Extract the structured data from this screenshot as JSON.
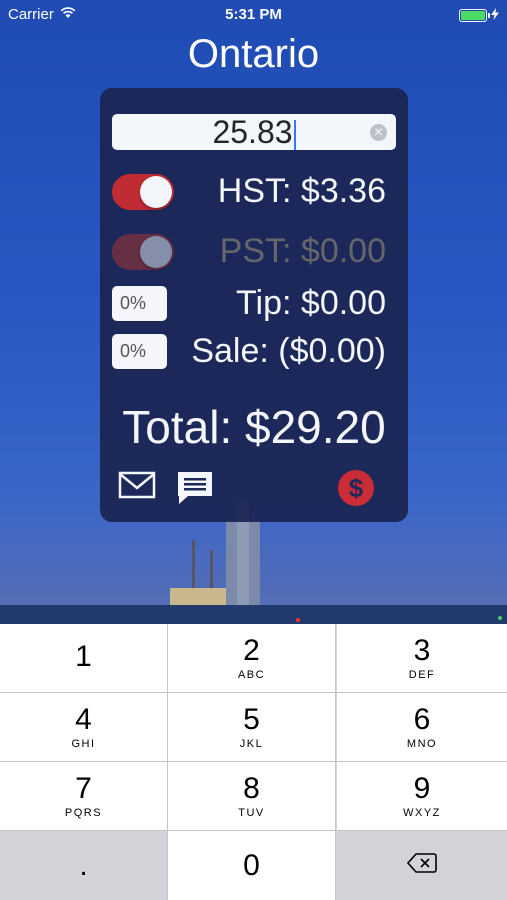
{
  "status_bar": {
    "carrier": "Carrier",
    "time": "5:31 PM"
  },
  "title": "Ontario",
  "calculator": {
    "amount": "25.83",
    "hst": {
      "label": "HST: $3.36",
      "enabled": true
    },
    "pst": {
      "label": "PST: $0.00",
      "enabled": false
    },
    "tip": {
      "percent": "0%",
      "label": "Tip: $0.00"
    },
    "sale": {
      "percent": "0%",
      "label": "Sale: ($0.00)"
    },
    "total": "Total: $29.20",
    "icons": [
      "mail-icon",
      "message-icon",
      "dollar-icon"
    ]
  },
  "colors": {
    "toggle_on": "#c9292d",
    "toggle_off": "#6a2d3d",
    "panel": "#1b2654",
    "dollar_button": "#d22a2e"
  },
  "keypad": {
    "keys": [
      {
        "num": "1",
        "letters": ""
      },
      {
        "num": "2",
        "letters": "ABC"
      },
      {
        "num": "3",
        "letters": "DEF"
      },
      {
        "num": "4",
        "letters": "GHI"
      },
      {
        "num": "5",
        "letters": "JKL"
      },
      {
        "num": "6",
        "letters": "MNO"
      },
      {
        "num": "7",
        "letters": "PQRS"
      },
      {
        "num": "8",
        "letters": "TUV"
      },
      {
        "num": "9",
        "letters": "WXYZ"
      }
    ],
    "decimal": ".",
    "zero": "0"
  }
}
